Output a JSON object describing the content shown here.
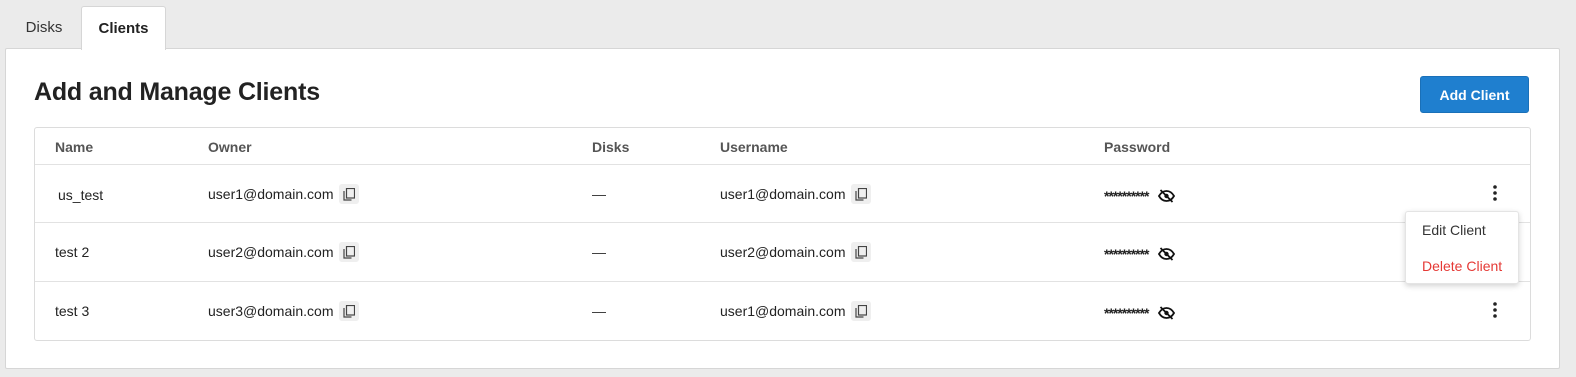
{
  "tabs": [
    {
      "label": "Disks",
      "active": false
    },
    {
      "label": "Clients",
      "active": true
    }
  ],
  "page": {
    "title": "Add and Manage Clients",
    "add_button_label": "Add Client"
  },
  "colors": {
    "accent": "#1f7fcf",
    "danger": "#e53935"
  },
  "table": {
    "headers": {
      "name": "Name",
      "owner": "Owner",
      "disks": "Disks",
      "username": "Username",
      "password": "Password"
    },
    "rows": [
      {
        "name": "us_test",
        "owner": "user1@domain.com",
        "disks": "—",
        "username": "user1@domain.com",
        "password": "**********"
      },
      {
        "name": "test 2",
        "owner": "user2@domain.com",
        "disks": "—",
        "username": "user2@domain.com",
        "password": "**********"
      },
      {
        "name": "test 3",
        "owner": "user3@domain.com",
        "disks": "—",
        "username": "user1@domain.com",
        "password": "**********"
      }
    ]
  },
  "row_menu": {
    "items": [
      {
        "label": "Edit Client"
      },
      {
        "label": "Delete Client"
      }
    ]
  },
  "icons": {
    "copy": "copy-icon",
    "visibility_off": "eye-off-icon",
    "more": "more-vertical-icon"
  }
}
